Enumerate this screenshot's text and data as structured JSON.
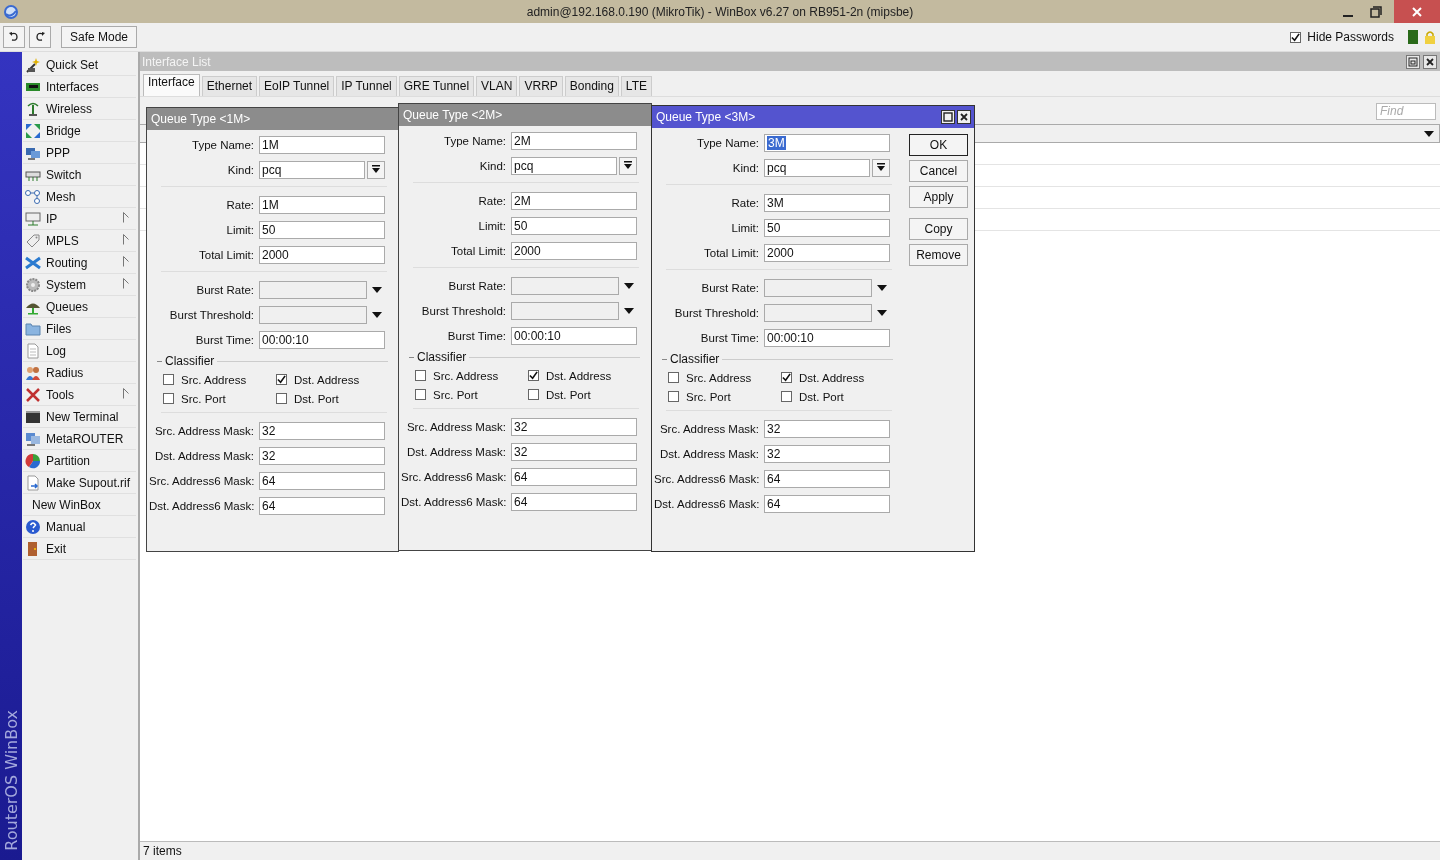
{
  "window": {
    "title": "admin@192.168.0.190 (MikroTik) - WinBox v6.27 on RB951-2n (mipsbe)"
  },
  "toolbar": {
    "safe_mode": "Safe Mode",
    "hide_passwords": {
      "label": "Hide Passwords",
      "checked": true
    }
  },
  "brand": "RouterOS WinBox",
  "sidebar": {
    "items": [
      {
        "label": "Quick Set",
        "submenu": false
      },
      {
        "label": "Interfaces",
        "submenu": false
      },
      {
        "label": "Wireless",
        "submenu": false
      },
      {
        "label": "Bridge",
        "submenu": false
      },
      {
        "label": "PPP",
        "submenu": false
      },
      {
        "label": "Switch",
        "submenu": false
      },
      {
        "label": "Mesh",
        "submenu": false
      },
      {
        "label": "IP",
        "submenu": true
      },
      {
        "label": "MPLS",
        "submenu": true
      },
      {
        "label": "Routing",
        "submenu": true
      },
      {
        "label": "System",
        "submenu": true
      },
      {
        "label": "Queues",
        "submenu": false
      },
      {
        "label": "Files",
        "submenu": false
      },
      {
        "label": "Log",
        "submenu": false
      },
      {
        "label": "Radius",
        "submenu": false
      },
      {
        "label": "Tools",
        "submenu": true
      },
      {
        "label": "New Terminal",
        "submenu": false
      },
      {
        "label": "MetaROUTER",
        "submenu": false
      },
      {
        "label": "Partition",
        "submenu": false
      },
      {
        "label": "Make Supout.rif",
        "submenu": false
      },
      {
        "label": "New WinBox",
        "submenu": false
      },
      {
        "label": "Manual",
        "submenu": false
      },
      {
        "label": "Exit",
        "submenu": false
      }
    ]
  },
  "interface_list": {
    "title": "Interface List",
    "tabs": [
      {
        "label": "Interface",
        "selected": true
      },
      {
        "label": "Ethernet",
        "selected": false
      },
      {
        "label": "EoIP Tunnel",
        "selected": false
      },
      {
        "label": "IP Tunnel",
        "selected": false
      },
      {
        "label": "GRE Tunnel",
        "selected": false
      },
      {
        "label": "VLAN",
        "selected": false
      },
      {
        "label": "VRRP",
        "selected": false
      },
      {
        "label": "Bonding",
        "selected": false
      },
      {
        "label": "LTE",
        "selected": false
      }
    ],
    "find_placeholder": "Find",
    "status": "7 items"
  },
  "dialogs": [
    {
      "title": "Queue Type <1M>",
      "active": false,
      "rows": [
        {
          "kind": "text",
          "label": "Type Name:",
          "value": "1M",
          "selected": false
        },
        {
          "kind": "select",
          "label": "Kind:",
          "value": "pcq"
        },
        {
          "kind": "separator"
        },
        {
          "kind": "text",
          "label": "Rate:",
          "value": "1M"
        },
        {
          "kind": "text",
          "label": "Limit:",
          "value": "50"
        },
        {
          "kind": "text",
          "label": "Total Limit:",
          "value": "2000"
        },
        {
          "kind": "separator"
        },
        {
          "kind": "dropdown",
          "label": "Burst Rate:"
        },
        {
          "kind": "dropdown",
          "label": "Burst Threshold:"
        },
        {
          "kind": "text",
          "label": "Burst Time:",
          "value": "00:00:10"
        },
        {
          "kind": "group",
          "label": "Classifier",
          "options": [
            {
              "label": "Src. Address",
              "checked": false
            },
            {
              "label": "Dst. Address",
              "checked": true
            },
            {
              "label": "Src. Port",
              "checked": false
            },
            {
              "label": "Dst. Port",
              "checked": false
            }
          ]
        },
        {
          "kind": "separator"
        },
        {
          "kind": "text",
          "label": "Src. Address Mask:",
          "value": "32"
        },
        {
          "kind": "text",
          "label": "Dst. Address Mask:",
          "value": "32"
        },
        {
          "kind": "text",
          "label": "Src. Address6 Mask:",
          "value": "64"
        },
        {
          "kind": "text",
          "label": "Dst. Address6 Mask:",
          "value": "64"
        }
      ]
    },
    {
      "title": "Queue Type <2M>",
      "active": false,
      "rows": [
        {
          "kind": "text",
          "label": "Type Name:",
          "value": "2M",
          "selected": false
        },
        {
          "kind": "select",
          "label": "Kind:",
          "value": "pcq"
        },
        {
          "kind": "separator"
        },
        {
          "kind": "text",
          "label": "Rate:",
          "value": "2M"
        },
        {
          "kind": "text",
          "label": "Limit:",
          "value": "50"
        },
        {
          "kind": "text",
          "label": "Total Limit:",
          "value": "2000"
        },
        {
          "kind": "separator"
        },
        {
          "kind": "dropdown",
          "label": "Burst Rate:"
        },
        {
          "kind": "dropdown",
          "label": "Burst Threshold:"
        },
        {
          "kind": "text",
          "label": "Burst Time:",
          "value": "00:00:10"
        },
        {
          "kind": "group",
          "label": "Classifier",
          "options": [
            {
              "label": "Src. Address",
              "checked": false
            },
            {
              "label": "Dst. Address",
              "checked": true
            },
            {
              "label": "Src. Port",
              "checked": false
            },
            {
              "label": "Dst. Port",
              "checked": false
            }
          ]
        },
        {
          "kind": "separator"
        },
        {
          "kind": "text",
          "label": "Src. Address Mask:",
          "value": "32"
        },
        {
          "kind": "text",
          "label": "Dst. Address Mask:",
          "value": "32"
        },
        {
          "kind": "text",
          "label": "Src. Address6 Mask:",
          "value": "64"
        },
        {
          "kind": "text",
          "label": "Dst. Address6 Mask:",
          "value": "64"
        }
      ]
    },
    {
      "title": "Queue Type <3M>",
      "active": true,
      "buttons": [
        "OK",
        "Cancel",
        "Apply",
        "Copy",
        "Remove"
      ],
      "rows": [
        {
          "kind": "text",
          "label": "Type Name:",
          "value": "3M",
          "selected": true
        },
        {
          "kind": "select",
          "label": "Kind:",
          "value": "pcq"
        },
        {
          "kind": "separator"
        },
        {
          "kind": "text",
          "label": "Rate:",
          "value": "3M"
        },
        {
          "kind": "text",
          "label": "Limit:",
          "value": "50"
        },
        {
          "kind": "text",
          "label": "Total Limit:",
          "value": "2000"
        },
        {
          "kind": "separator"
        },
        {
          "kind": "dropdown",
          "label": "Burst Rate:"
        },
        {
          "kind": "dropdown",
          "label": "Burst Threshold:"
        },
        {
          "kind": "text",
          "label": "Burst Time:",
          "value": "00:00:10"
        },
        {
          "kind": "group",
          "label": "Classifier",
          "options": [
            {
              "label": "Src. Address",
              "checked": false
            },
            {
              "label": "Dst. Address",
              "checked": true
            },
            {
              "label": "Src. Port",
              "checked": false
            },
            {
              "label": "Dst. Port",
              "checked": false
            }
          ]
        },
        {
          "kind": "separator"
        },
        {
          "kind": "text",
          "label": "Src. Address Mask:",
          "value": "32"
        },
        {
          "kind": "text",
          "label": "Dst. Address Mask:",
          "value": "32"
        },
        {
          "kind": "text",
          "label": "Src. Address6 Mask:",
          "value": "64"
        },
        {
          "kind": "text",
          "label": "Dst. Address6 Mask:",
          "value": "64"
        }
      ]
    }
  ]
}
